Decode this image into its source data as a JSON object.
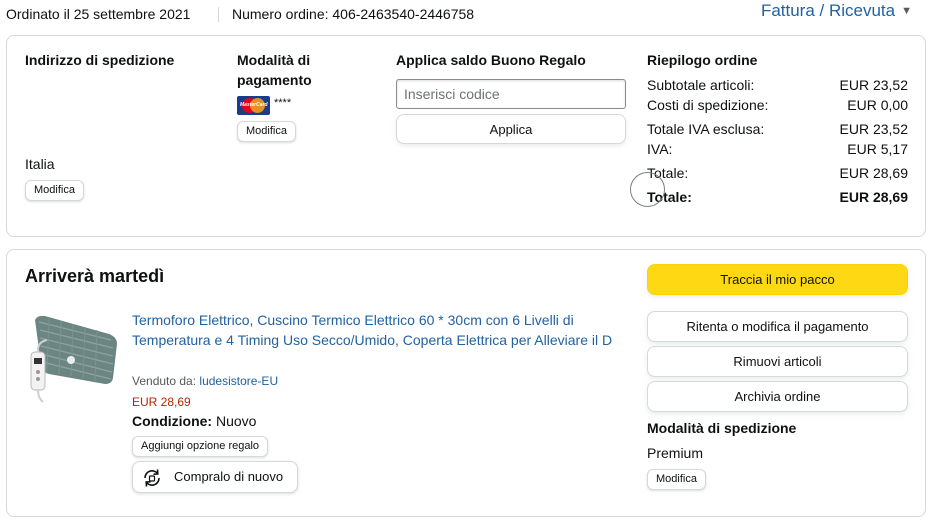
{
  "header": {
    "order_date": "Ordinato il 25 settembre 2021",
    "order_number": "Numero ordine: 406-2463540-2446758",
    "invoice_link": "Fattura / Ricevuta",
    "invoice_icon": "chevron-down-icon"
  },
  "summary": {
    "shipping_address": {
      "title": "Indirizzo di spedizione",
      "country": "Italia",
      "edit_label": "Modifica"
    },
    "payment": {
      "title": "Modalità di pagamento",
      "card_mask": "****",
      "card_brand": "MasterCard",
      "edit_label": "Modifica"
    },
    "gift_card": {
      "title": "Applica saldo Buono Regalo",
      "placeholder": "Inserisci codice",
      "apply_label": "Applica"
    },
    "order_summary": {
      "title": "Riepilogo ordine",
      "rows": [
        {
          "label": "Subtotale articoli:",
          "value": "EUR 23,52"
        },
        {
          "label": "Costi di spedizione:",
          "value": "EUR 0,00"
        },
        {
          "label": "Totale IVA esclusa:",
          "value": "EUR 23,52"
        },
        {
          "label": "IVA:",
          "value": "EUR 5,17"
        },
        {
          "label": "Totale:",
          "value": "EUR 28,69"
        }
      ],
      "grand_total": {
        "label": "Totale:",
        "value": "EUR 28,69"
      }
    }
  },
  "shipment": {
    "arrival_title": "Arriverà martedì",
    "product": {
      "title": "Termoforo Elettrico, Cuscino Termico Elettrico 60 * 30cm con 6 Livelli di Temperatura e 4 Timing Uso Secco/Umido, Coperta Elettrica per Alleviare il D",
      "sold_by_label": "Venduto da:",
      "seller": "ludesistore-EU",
      "price": "EUR 28,69",
      "condition_label": "Condizione:",
      "condition_value": "Nuovo",
      "gift_option_label": "Aggiungi opzione regalo",
      "rebuy_label": "Compralo di nuovo",
      "rebuy_icon": "rebuy-icon"
    },
    "actions": {
      "track": "Traccia il mio pacco",
      "retry_payment": "Ritenta o modifica il pagamento",
      "remove_items": "Rimuovi articoli",
      "archive": "Archivia ordine"
    },
    "shipping_mode": {
      "title": "Modalità di spedizione",
      "value": "Premium",
      "edit_label": "Modifica"
    }
  },
  "colors": {
    "link": "#2162a1",
    "price": "#b12704",
    "primary_button": "#ffd814",
    "border": "#d5d9d9"
  }
}
